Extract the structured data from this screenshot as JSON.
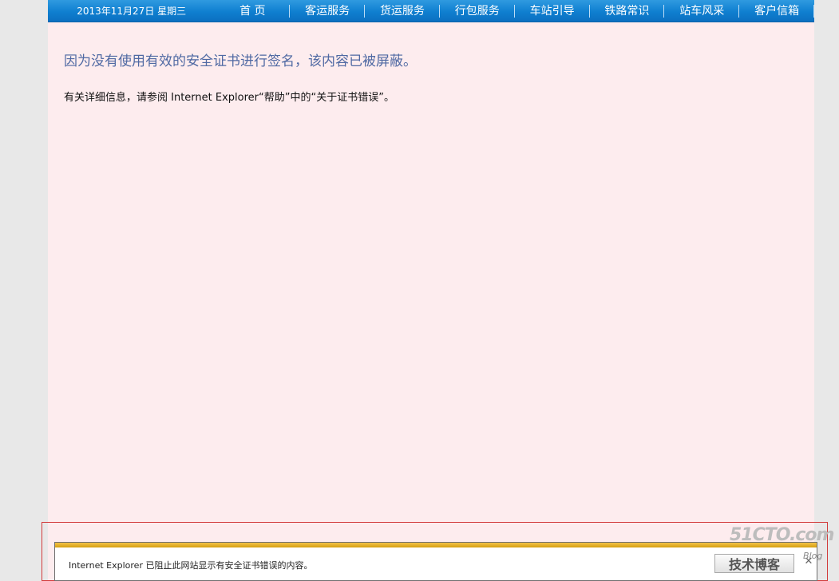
{
  "nav": {
    "date": "2013年11月27日 星期三",
    "items": [
      "首 页",
      "客运服务",
      "货运服务",
      "行包服务",
      "车站引导",
      "铁路常识",
      "站车风采",
      "客户信箱"
    ]
  },
  "content": {
    "heading": "因为没有使用有效的安全证书进行签名，该内容已被屏蔽。",
    "detail": "有关详细信息，请参阅 Internet Explorer“帮助”中的“关于证书错误”。"
  },
  "notification": {
    "text": "Internet Explorer 已阻止此网站显示有安全证书错误的内容。",
    "button_label": "技术博客",
    "close_icon": "close-icon"
  },
  "watermark": {
    "brand": "51CTO.com",
    "blog": "Blog"
  },
  "colors": {
    "nav_bg": "#0f7fd0",
    "page_bg": "#fdecee",
    "heading": "#4f69a3",
    "notification_stripe": "#e0aa1c",
    "frame_border": "#d23b3b"
  }
}
